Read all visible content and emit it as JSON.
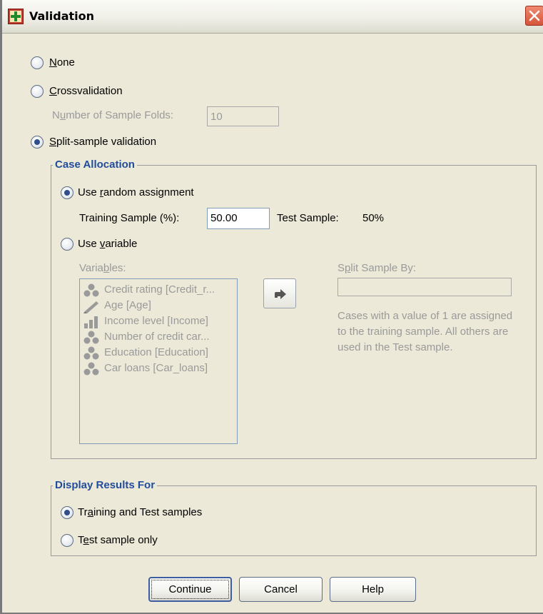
{
  "window": {
    "title": "Validation",
    "colors": {
      "accent": "#224c9c",
      "close": "#d4553a",
      "disabled_text": "#9a9a9a",
      "dialog_bg": "#ece9d8"
    }
  },
  "options": {
    "none": {
      "pre": "",
      "mn": "N",
      "post": "one",
      "checked": false
    },
    "crossvalidation": {
      "pre": "",
      "mn": "C",
      "post": "rossvalidation",
      "checked": false
    },
    "folds": {
      "pre": "N",
      "mn": "u",
      "post": "mber of Sample Folds:",
      "value": "10"
    },
    "split_sample": {
      "pre": "",
      "mn": "S",
      "post": "plit-sample validation",
      "checked": true
    }
  },
  "case_allocation": {
    "legend": "Case Allocation",
    "random": {
      "pre": "Use ",
      "mn": "r",
      "post": "andom assignment",
      "checked": true
    },
    "training_sample": {
      "pre": "Trainin",
      "mn": "g",
      "post": " Sample (%):",
      "value": "50.00"
    },
    "test_sample": {
      "label": "Test Sample:",
      "value": "50%"
    },
    "use_variable": {
      "pre": "Use ",
      "mn": "v",
      "post": "ariable",
      "checked": false
    },
    "variables": {
      "pre": "Varia",
      "mn": "b",
      "post": "les:",
      "items": [
        {
          "label": "Credit rating [Credit_r...",
          "icon": "nominal-icon"
        },
        {
          "label": "Age [Age]",
          "icon": "scale-icon"
        },
        {
          "label": "Income level [Income]",
          "icon": "ordinal-icon"
        },
        {
          "label": "Number of credit car...",
          "icon": "nominal-icon"
        },
        {
          "label": "Education [Education]",
          "icon": "nominal-icon"
        },
        {
          "label": "Car loans [Car_loans]",
          "icon": "nominal-icon"
        }
      ]
    },
    "split_by": {
      "pre": "S",
      "mn": "p",
      "post": "lit Sample By:",
      "value": "",
      "description": "Cases with a value of 1 are assigned to the training sample. All others are used in the Test sample."
    }
  },
  "display_results": {
    "legend": "Display Results For",
    "training_and_test": {
      "pre": "Tr",
      "mn": "a",
      "post": "ining and Test samples",
      "checked": true
    },
    "test_only": {
      "pre": "T",
      "mn": "e",
      "post": "st sample only",
      "checked": false
    }
  },
  "buttons": {
    "continue": "Continue",
    "cancel": "Cancel",
    "help": "Help"
  }
}
